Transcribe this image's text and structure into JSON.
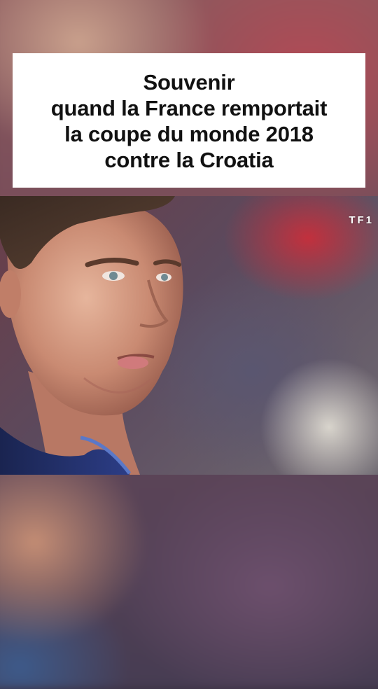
{
  "caption": {
    "lines": [
      "Souvenir",
      "quand la France remportait",
      "la coupe du monde 2018",
      "contre la Croatia"
    ]
  },
  "video": {
    "channel_logo": "TF1"
  },
  "colors": {
    "caption_bg": "#ffffff",
    "caption_text": "#111111",
    "jersey": "#1d2a63",
    "stadium_red": "#c2303d"
  }
}
